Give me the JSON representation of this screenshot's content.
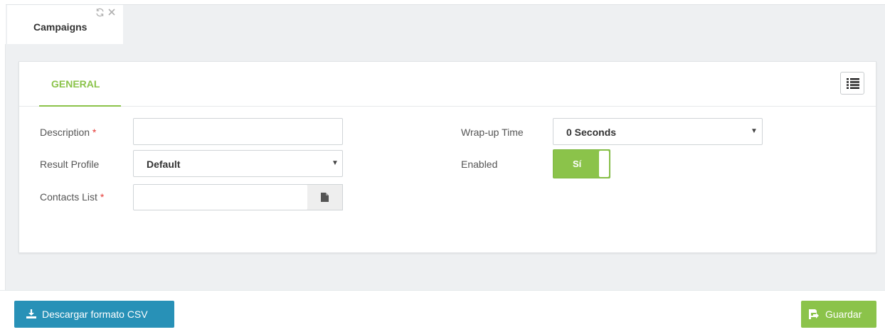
{
  "tabs": [
    {
      "label": "Campaigns",
      "refresh_icon": "refresh-icon",
      "close_icon": "close-icon"
    }
  ],
  "panel": {
    "tab_general": "GENERAL",
    "list_icon": "list-icon",
    "fields": {
      "description": {
        "label": "Description",
        "required": "*",
        "value": ""
      },
      "result_profile": {
        "label": "Result Profile",
        "value": "Default"
      },
      "contacts_list": {
        "label": "Contacts List",
        "required": "*",
        "value": "",
        "file_icon": "file-icon"
      },
      "wrapup_time": {
        "label": "Wrap-up Time",
        "value": "0 Seconds"
      },
      "enabled": {
        "label": "Enabled",
        "value": "Sí"
      }
    }
  },
  "footer": {
    "csv_button": "Descargar formato CSV",
    "save_button": "Guardar"
  },
  "colors": {
    "accent_green": "#8bc34a",
    "csv_blue": "#2891b7",
    "required_red": "#e53935"
  }
}
